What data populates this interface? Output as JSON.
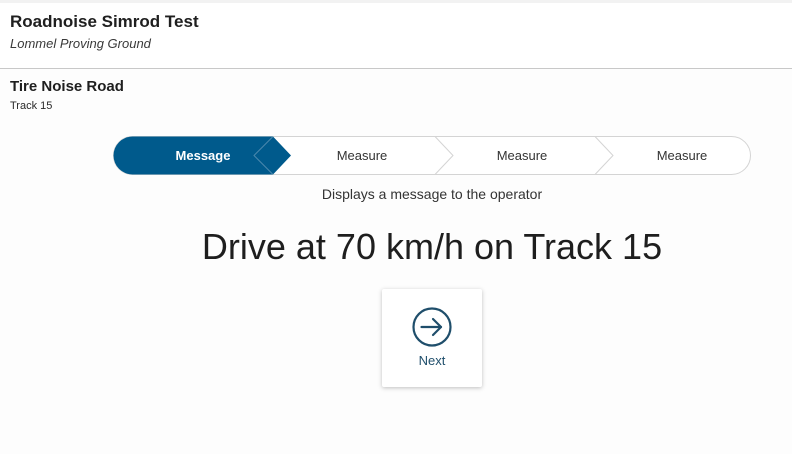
{
  "app": {
    "title": "Roadnoise Simrod Test",
    "subtitle": "Lommel Proving Ground"
  },
  "section": {
    "title": "Tire Noise Road",
    "subtitle": "Track 15"
  },
  "stepper": {
    "active_index": 0,
    "active_color": "#005a8c",
    "steps": [
      {
        "label": "Message"
      },
      {
        "label": "Measure"
      },
      {
        "label": "Measure"
      },
      {
        "label": "Measure"
      }
    ],
    "description": "Displays a message to the operator"
  },
  "message": {
    "text": "Drive at 70 km/h on Track 15"
  },
  "next_button": {
    "label": "Next",
    "icon": "arrow-right-circle-icon",
    "color": "#1f4e6b"
  }
}
